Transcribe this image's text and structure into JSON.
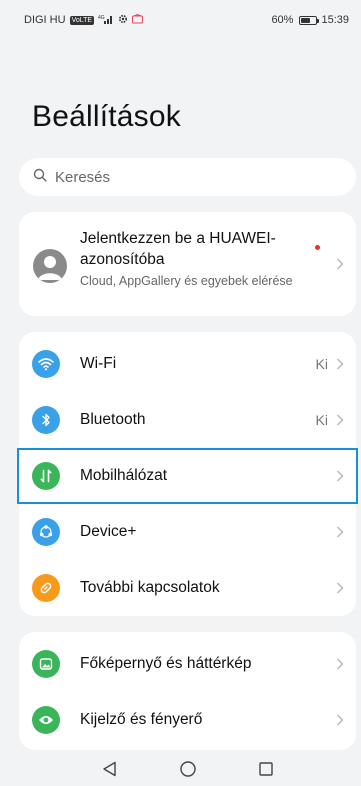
{
  "status_bar": {
    "carrier": "DIGI HU",
    "volte_badge": "VoLTE",
    "signal": "4G",
    "battery_percent": "60%",
    "battery_level": 0.6,
    "time": "15:39"
  },
  "page": {
    "title": "Beállítások"
  },
  "search": {
    "placeholder": "Keresés"
  },
  "account": {
    "title": "Jelentkezzen be a HUAWEI-azonosítóba",
    "subtitle": "Cloud, AppGallery és egyebek elérése"
  },
  "connectivity": [
    {
      "id": "wifi",
      "label": "Wi-Fi",
      "value": "Ki",
      "color": "#3aa0e8",
      "icon": "wifi-icon"
    },
    {
      "id": "bluetooth",
      "label": "Bluetooth",
      "value": "Ki",
      "color": "#3aa0e8",
      "icon": "bluetooth-icon"
    },
    {
      "id": "mobile-network",
      "label": "Mobilhálózat",
      "value": "",
      "color": "#3bb55a",
      "icon": "mobile-data-icon",
      "highlighted": true
    },
    {
      "id": "device-plus",
      "label": "Device+",
      "value": "",
      "color": "#3aa0e8",
      "icon": "device-plus-icon"
    },
    {
      "id": "more-connections",
      "label": "További kapcsolatok",
      "value": "",
      "color": "#f59a1b",
      "icon": "link-icon"
    }
  ],
  "display": [
    {
      "id": "home-wallpaper",
      "label": "Főképernyő és háttérkép",
      "color": "#3bb55a",
      "icon": "wallpaper-icon"
    },
    {
      "id": "display-brightness",
      "label": "Kijelző és fényerő",
      "color": "#3bb55a",
      "icon": "eye-icon"
    }
  ],
  "nav": [
    "back-icon",
    "home-icon",
    "recents-icon"
  ]
}
